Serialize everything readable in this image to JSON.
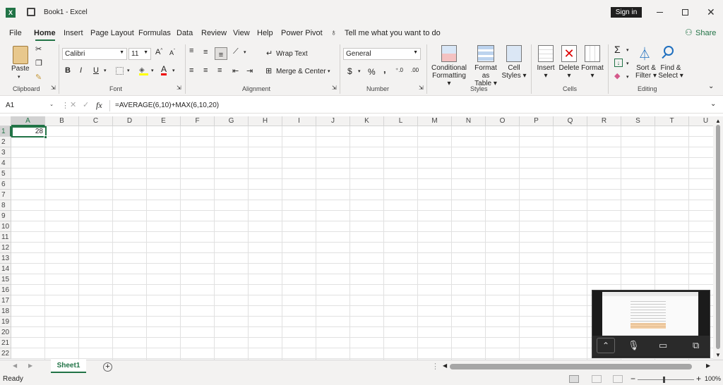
{
  "title": {
    "app_text": "Book1  -  Excel",
    "sign_in": "Sign in"
  },
  "menu": [
    "File",
    "Home",
    "Insert",
    "Page Layout",
    "Formulas",
    "Data",
    "Review",
    "View",
    "Help",
    "Power Pivot"
  ],
  "tell_me": "Tell me what you want to do",
  "share": "Share",
  "ribbon": {
    "clipboard": {
      "paste": "Paste",
      "label": "Clipboard"
    },
    "font": {
      "name": "Calibri",
      "size": "11",
      "label": "Font",
      "bold": "B",
      "italic": "I",
      "underline": "U"
    },
    "alignment": {
      "wrap": "Wrap Text",
      "merge": "Merge & Center",
      "label": "Alignment"
    },
    "number": {
      "format": "General",
      "currency": "$",
      "percent": "%",
      "comma": ",",
      "label": "Number"
    },
    "styles": {
      "conditional": [
        "Conditional",
        "Formatting"
      ],
      "format_table": [
        "Format as",
        "Table"
      ],
      "cell_styles": [
        "Cell",
        "Styles"
      ],
      "label": "Styles"
    },
    "cells": {
      "insert": "Insert",
      "delete": "Delete",
      "format": "Format",
      "label": "Cells"
    },
    "editing": {
      "sort": [
        "Sort &",
        "Filter"
      ],
      "find": [
        "Find &",
        "Select"
      ],
      "label": "Editing"
    }
  },
  "formula_bar": {
    "name_box": "A1",
    "fx": "fx",
    "formula": "=AVERAGE(6,10)+MAX(6,10,20)"
  },
  "columns": [
    "A",
    "B",
    "C",
    "D",
    "E",
    "F",
    "G",
    "H",
    "I",
    "J",
    "K",
    "L",
    "M",
    "N",
    "O",
    "P",
    "Q",
    "R",
    "S",
    "T",
    "U"
  ],
  "rows": [
    "1",
    "2",
    "3",
    "4",
    "5",
    "6",
    "7",
    "8",
    "9",
    "10",
    "11",
    "12",
    "13",
    "14",
    "15",
    "16",
    "17",
    "18",
    "19",
    "20",
    "21",
    "22"
  ],
  "cell_a1": "28",
  "sheet_tab": "Sheet1",
  "status": {
    "ready": "Ready",
    "zoom": "100%"
  },
  "colors": {
    "excel_green": "#217346",
    "selection": "#217346",
    "chrome": "#f3f2f1"
  }
}
